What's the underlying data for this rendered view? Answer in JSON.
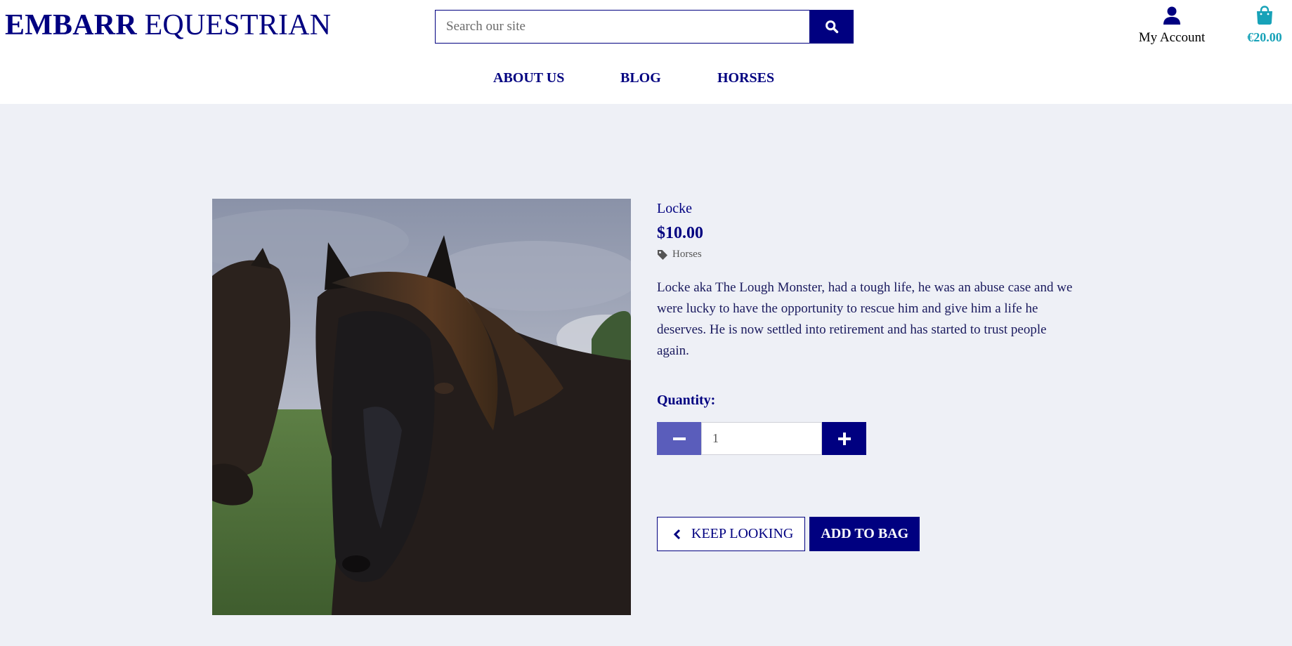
{
  "brand": {
    "name_bold": "EMBARR",
    "name_regular": "EQUESTRIAN"
  },
  "search": {
    "placeholder": "Search our site",
    "icon": "search-icon"
  },
  "account": {
    "label": "My Account",
    "icon": "user-icon"
  },
  "bag": {
    "total": "€20.00",
    "icon": "shopping-bag-icon"
  },
  "nav": {
    "items": [
      "ABOUT US",
      "BLOG",
      "HORSES"
    ]
  },
  "product": {
    "name": "Locke",
    "price": "$10.00",
    "category": "Horses",
    "category_icon": "tag-icon",
    "description": "Locke aka The Lough Monster, had a tough life, he was an abuse case and we were lucky to have the opportunity to rescue him and give him a life he deserves. He is now settled into retirement and has started to trust people again.",
    "image_icon": "horse-photo"
  },
  "quantity": {
    "label": "Quantity:",
    "value": "1",
    "minus_icon": "minus-icon",
    "plus_icon": "plus-icon"
  },
  "actions": {
    "keep_looking": "KEEP LOOKING",
    "keep_icon": "chevron-left-icon",
    "add_to_bag": "ADD TO BAG"
  },
  "colors": {
    "primary": "#000080",
    "accent": "#17a2b8",
    "minus_button": "#5a5dbb",
    "page_background": "#eef0f6"
  }
}
